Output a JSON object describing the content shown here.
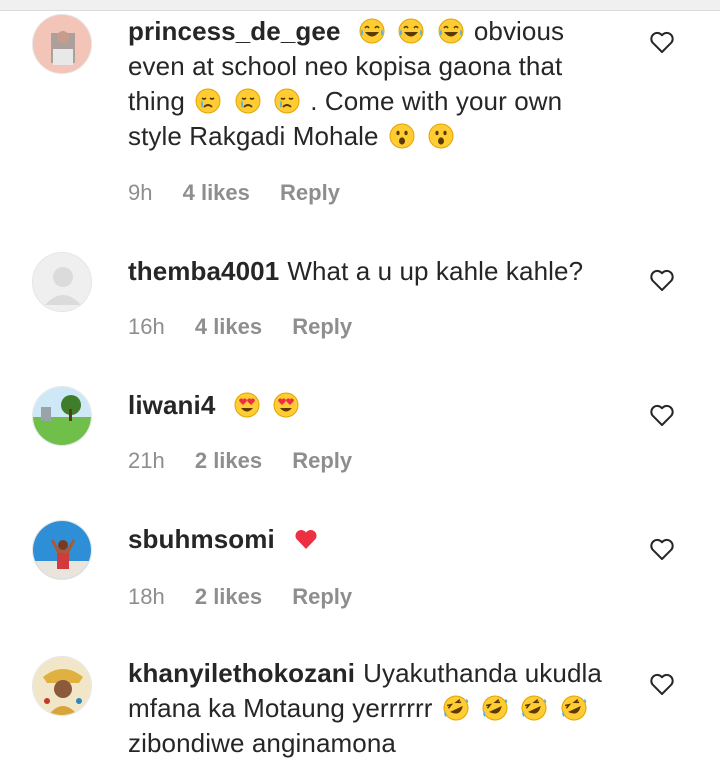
{
  "comments": [
    {
      "username": "princess_de_gee",
      "segments": [
        "",
        " obvious even at school neo kopisa gaona that thing",
        ". Come with your own style Rakgadi Mohale"
      ],
      "time": "9h",
      "likes": "4 likes",
      "reply": "Reply",
      "avatar": "avatar-photo-person"
    },
    {
      "username": "themba4001",
      "segments": [
        "What a u up kahle kahle?"
      ],
      "time": "16h",
      "likes": "4 likes",
      "reply": "Reply",
      "avatar": "default-avatar"
    },
    {
      "username": "liwani4",
      "segments": [
        ""
      ],
      "time": "21h",
      "likes": "2 likes",
      "reply": "Reply",
      "avatar": "avatar-photo-grass"
    },
    {
      "username": "sbuhmsomi",
      "segments": [
        ""
      ],
      "time": "18h",
      "likes": "2 likes",
      "reply": "Reply",
      "avatar": "avatar-photo-figure"
    },
    {
      "username": "khanyilethokozani",
      "segments": [
        "Uyakuthanda ukudla mfana ka Motaung yerrrrrr",
        "zibondiwe anginamona"
      ],
      "time": "",
      "likes": "",
      "reply": "",
      "avatar": "avatar-photo-costume"
    }
  ],
  "icons": {
    "like": "heart-outline-icon",
    "laugh": "tears-of-joy-emoji",
    "cry": "crying-face-emoji",
    "astonished": "astonished-face-emoji",
    "heart_eyes": "heart-eyes-emoji",
    "red_heart": "red-heart-emoji",
    "rofl": "rolling-laughing-emoji"
  },
  "colors": {
    "text": "#262626",
    "meta": "#8e8e8e",
    "heart": "#ed2f42",
    "emoji": "#ffcc33"
  }
}
